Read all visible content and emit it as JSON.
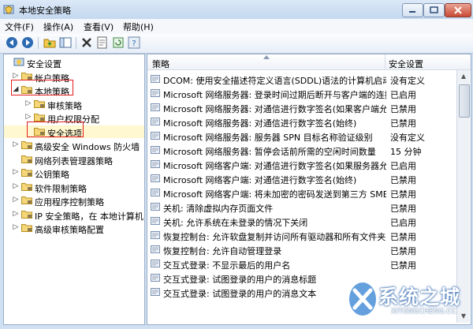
{
  "window": {
    "title": "本地安全策略"
  },
  "menu": [
    "文件(F)",
    "操作(A)",
    "查看(V)",
    "帮助(H)"
  ],
  "toolbar": [
    "back-icon",
    "forward-icon",
    "up-folder-icon",
    "show-tree-icon",
    "delete-icon",
    "properties-icon",
    "refresh-icon",
    "help-icon"
  ],
  "tree": [
    {
      "label": "安全设置",
      "toggle": "",
      "level": 0
    },
    {
      "label": "帐户策略",
      "toggle": "▷",
      "level": 1
    },
    {
      "label": "本地策略",
      "toggle": "◢",
      "level": 1
    },
    {
      "label": "审核策略",
      "toggle": "▷",
      "level": 2
    },
    {
      "label": "用户权限分配",
      "toggle": "▷",
      "level": 2
    },
    {
      "label": "安全选项",
      "toggle": "",
      "level": 2
    },
    {
      "label": "高级安全 Windows 防火墙",
      "toggle": "▷",
      "level": 1
    },
    {
      "label": "网络列表管理器策略",
      "toggle": "",
      "level": 1
    },
    {
      "label": "公钥策略",
      "toggle": "▷",
      "level": 1
    },
    {
      "label": "软件限制策略",
      "toggle": "▷",
      "level": 1
    },
    {
      "label": "应用程序控制策略",
      "toggle": "▷",
      "level": 1
    },
    {
      "label": "IP 安全策略，在 本地计算机",
      "toggle": "▷",
      "level": 1
    },
    {
      "label": "高级审核策略配置",
      "toggle": "▷",
      "level": 1
    }
  ],
  "columns": {
    "policy": "策略",
    "setting": "安全设置"
  },
  "rows": [
    {
      "policy": "DCOM: 使用安全描述符定义语言(SDDL)语法的计算机启动...",
      "setting": "没有定义"
    },
    {
      "policy": "Microsoft 网络服务器: 登录时间过期后断开与客户端的连接",
      "setting": "已启用"
    },
    {
      "policy": "Microsoft 网络服务器: 对通信进行数字签名(如果客户端允...",
      "setting": "已禁用"
    },
    {
      "policy": "Microsoft 网络服务器: 对通信进行数字签名(始终)",
      "setting": "已禁用"
    },
    {
      "policy": "Microsoft 网络服务器: 服务器 SPN 目标名称验证级别",
      "setting": "没有定义"
    },
    {
      "policy": "Microsoft 网络服务器: 暂停会话前所需的空闲时间数量",
      "setting": "15 分钟"
    },
    {
      "policy": "Microsoft 网络客户端: 对通信进行数字签名(如果服务器允...",
      "setting": "已启用"
    },
    {
      "policy": "Microsoft 网络客户端: 对通信进行数字签名(始终)",
      "setting": "已禁用"
    },
    {
      "policy": "Microsoft 网络客户端: 将未加密的密码发送到第三方 SMB...",
      "setting": "已禁用"
    },
    {
      "policy": "关机: 清除虚拟内存页面文件",
      "setting": "已禁用"
    },
    {
      "policy": "关机: 允许系统在未登录的情况下关闭",
      "setting": "已启用"
    },
    {
      "policy": "恢复控制台: 允许软盘复制并访问所有驱动器和所有文件夹",
      "setting": "已禁用"
    },
    {
      "policy": "恢复控制台: 允许自动管理登录",
      "setting": "已禁用"
    },
    {
      "policy": "交互式登录: 不显示最后的用户名",
      "setting": "已禁用"
    },
    {
      "policy": "交互式登录: 试图登录的用户的消息标题",
      "setting": ""
    },
    {
      "policy": "交互式登录: 试图登录的用户的消息文本",
      "setting": ""
    }
  ],
  "logo": {
    "title": "系统之城",
    "subtitle": "XITONGCHENG.CC"
  },
  "colors": {
    "highlight_border": "#e31c1c",
    "selected_bg": "#fff8d1",
    "accent": "#2c6ab2"
  }
}
